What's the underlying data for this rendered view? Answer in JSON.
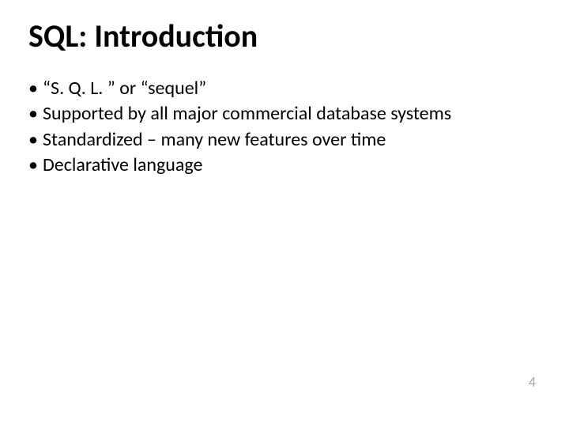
{
  "slide": {
    "title": "SQL: Introduction",
    "bullets": [
      "“S. Q. L. ” or “sequel”",
      "Supported by all major commercial database systems",
      "Standardized – many new features over time",
      "Declarative language"
    ],
    "page_number": "4"
  }
}
